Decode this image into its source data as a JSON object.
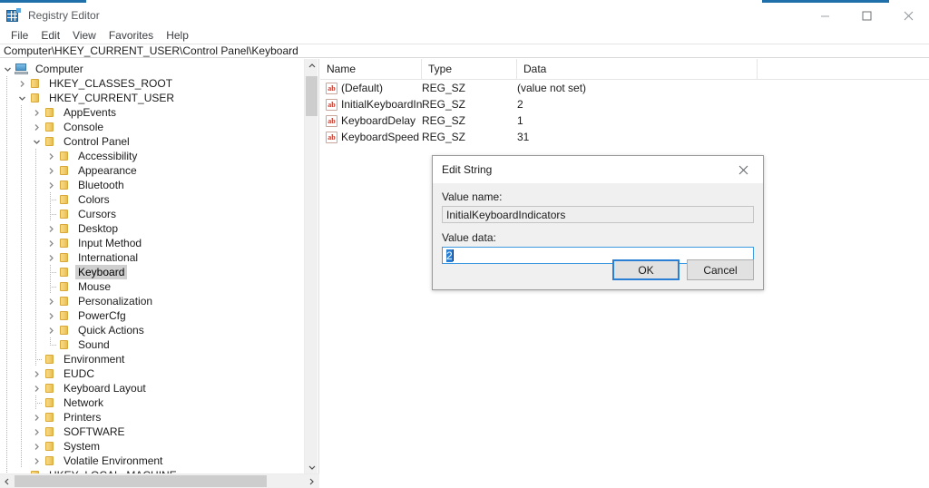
{
  "window": {
    "title": "Registry Editor",
    "controls": {
      "minimize": "minimize",
      "maximize": "maximize",
      "close": "close"
    }
  },
  "menu": {
    "items": [
      {
        "label": "File"
      },
      {
        "label": "Edit"
      },
      {
        "label": "View"
      },
      {
        "label": "Favorites"
      },
      {
        "label": "Help"
      }
    ]
  },
  "address": {
    "path": "Computer\\HKEY_CURRENT_USER\\Control Panel\\Keyboard"
  },
  "tree": {
    "nodes": [
      {
        "label": "Computer",
        "depth": 0,
        "icon": "computer-icon",
        "twist": "expanded",
        "selected": false
      },
      {
        "label": "HKEY_CLASSES_ROOT",
        "depth": 1,
        "icon": "folder-icon",
        "twist": "collapsed",
        "selected": false
      },
      {
        "label": "HKEY_CURRENT_USER",
        "depth": 1,
        "icon": "folder-icon",
        "twist": "expanded",
        "selected": false
      },
      {
        "label": "AppEvents",
        "depth": 2,
        "icon": "folder-icon",
        "twist": "collapsed",
        "selected": false
      },
      {
        "label": "Console",
        "depth": 2,
        "icon": "folder-icon",
        "twist": "collapsed",
        "selected": false
      },
      {
        "label": "Control Panel",
        "depth": 2,
        "icon": "folder-icon",
        "twist": "expanded",
        "selected": false
      },
      {
        "label": "Accessibility",
        "depth": 3,
        "icon": "folder-icon",
        "twist": "collapsed",
        "selected": false
      },
      {
        "label": "Appearance",
        "depth": 3,
        "icon": "folder-icon",
        "twist": "collapsed",
        "selected": false
      },
      {
        "label": "Bluetooth",
        "depth": 3,
        "icon": "folder-icon",
        "twist": "collapsed",
        "selected": false
      },
      {
        "label": "Colors",
        "depth": 3,
        "icon": "folder-icon",
        "twist": "leaf",
        "selected": false
      },
      {
        "label": "Cursors",
        "depth": 3,
        "icon": "folder-icon",
        "twist": "leaf",
        "selected": false
      },
      {
        "label": "Desktop",
        "depth": 3,
        "icon": "folder-icon",
        "twist": "collapsed",
        "selected": false
      },
      {
        "label": "Input Method",
        "depth": 3,
        "icon": "folder-icon",
        "twist": "collapsed",
        "selected": false
      },
      {
        "label": "International",
        "depth": 3,
        "icon": "folder-icon",
        "twist": "collapsed",
        "selected": false
      },
      {
        "label": "Keyboard",
        "depth": 3,
        "icon": "folder-icon",
        "twist": "leaf",
        "selected": true
      },
      {
        "label": "Mouse",
        "depth": 3,
        "icon": "folder-icon",
        "twist": "leaf",
        "selected": false
      },
      {
        "label": "Personalization",
        "depth": 3,
        "icon": "folder-icon",
        "twist": "collapsed",
        "selected": false
      },
      {
        "label": "PowerCfg",
        "depth": 3,
        "icon": "folder-icon",
        "twist": "collapsed",
        "selected": false
      },
      {
        "label": "Quick Actions",
        "depth": 3,
        "icon": "folder-icon",
        "twist": "collapsed",
        "selected": false
      },
      {
        "label": "Sound",
        "depth": 3,
        "icon": "folder-icon",
        "twist": "leaf-last",
        "selected": false
      },
      {
        "label": "Environment",
        "depth": 2,
        "icon": "folder-icon",
        "twist": "leaf",
        "selected": false
      },
      {
        "label": "EUDC",
        "depth": 2,
        "icon": "folder-icon",
        "twist": "collapsed",
        "selected": false
      },
      {
        "label": "Keyboard Layout",
        "depth": 2,
        "icon": "folder-icon",
        "twist": "collapsed",
        "selected": false
      },
      {
        "label": "Network",
        "depth": 2,
        "icon": "folder-icon",
        "twist": "leaf",
        "selected": false
      },
      {
        "label": "Printers",
        "depth": 2,
        "icon": "folder-icon",
        "twist": "collapsed",
        "selected": false
      },
      {
        "label": "SOFTWARE",
        "depth": 2,
        "icon": "folder-icon",
        "twist": "collapsed",
        "selected": false
      },
      {
        "label": "System",
        "depth": 2,
        "icon": "folder-icon",
        "twist": "collapsed",
        "selected": false
      },
      {
        "label": "Volatile Environment",
        "depth": 2,
        "icon": "folder-icon",
        "twist": "collapsed",
        "selected": false
      },
      {
        "label": "HKEY_LOCAL_MACHINE",
        "depth": 1,
        "icon": "folder-icon",
        "twist": "expanded",
        "selected": false
      }
    ]
  },
  "list": {
    "columns": [
      {
        "label": "Name"
      },
      {
        "label": "Type"
      },
      {
        "label": "Data"
      }
    ],
    "rows": [
      {
        "name": "(Default)",
        "type": "REG_SZ",
        "data": "(value not set)",
        "icon": "string-value-icon"
      },
      {
        "name": "InitialKeyboardIn…",
        "type": "REG_SZ",
        "data": "2",
        "icon": "string-value-icon"
      },
      {
        "name": "KeyboardDelay",
        "type": "REG_SZ",
        "data": "1",
        "icon": "string-value-icon"
      },
      {
        "name": "KeyboardSpeed",
        "type": "REG_SZ",
        "data": "31",
        "icon": "string-value-icon"
      }
    ],
    "value_icon_text": "ab"
  },
  "dialog": {
    "title": "Edit String",
    "value_name_label": "Value name:",
    "value_name": "InitialKeyboardIndicators",
    "value_data_label": "Value data:",
    "value_data": "2",
    "ok_label": "OK",
    "cancel_label": "Cancel",
    "close": "close"
  },
  "colors": {
    "accent": "#1f6fab",
    "selection": "#2a7fd4",
    "tree_selection": "#cfcfcf",
    "dialog_bg": "#f0f0f0",
    "folder": "#f2cd6b"
  }
}
